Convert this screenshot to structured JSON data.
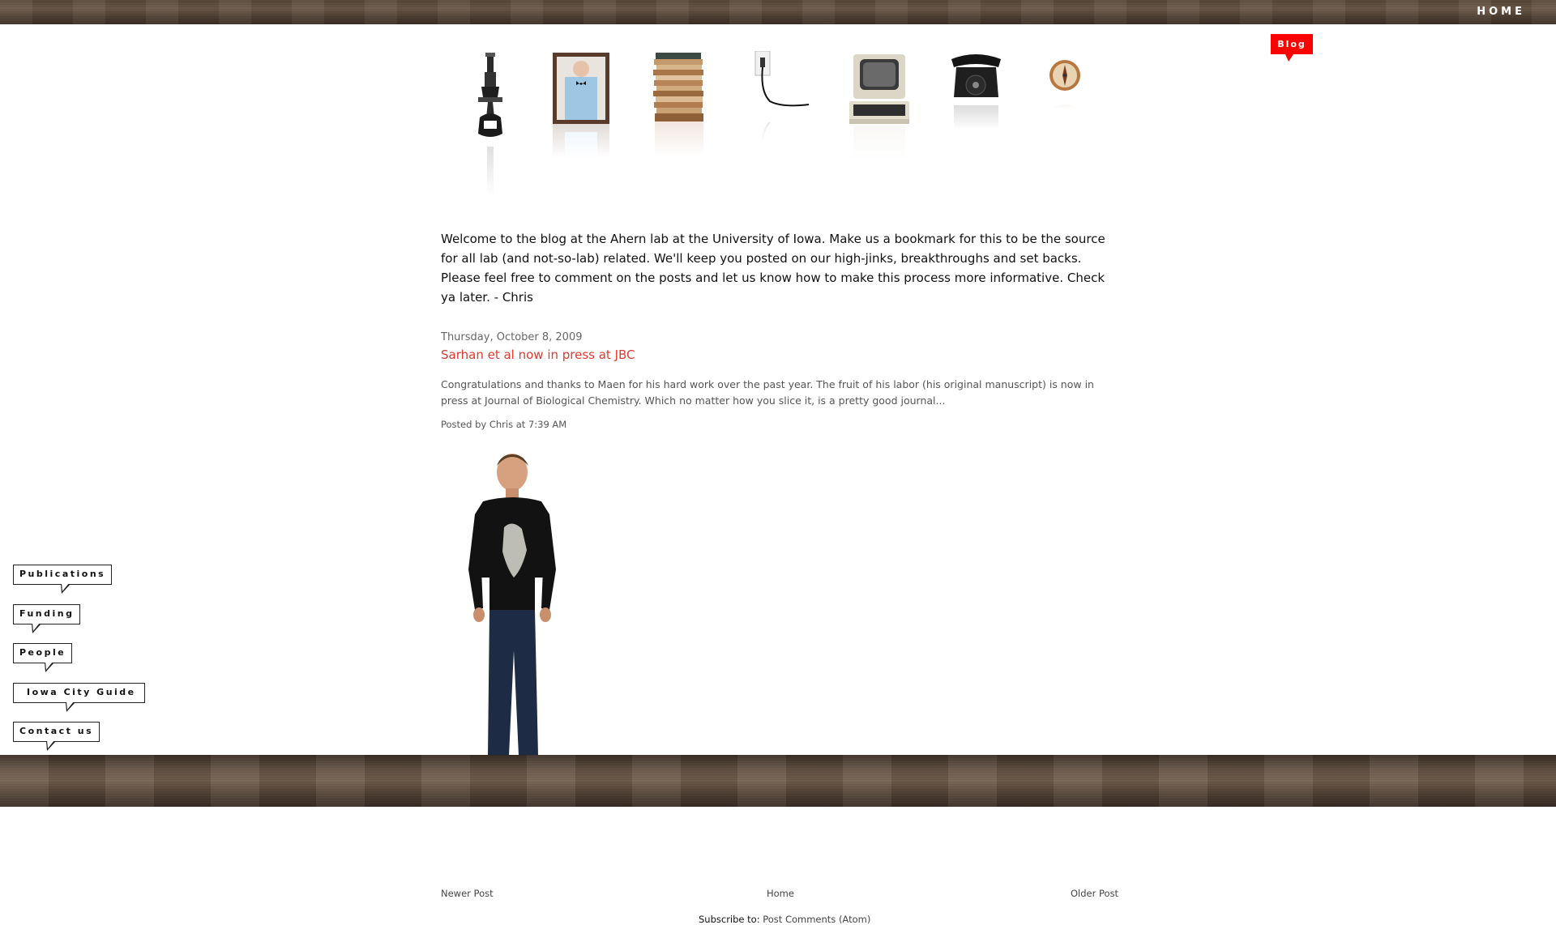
{
  "header": {
    "home_label": "HOME",
    "blog_label": "Blog"
  },
  "objects": [
    {
      "name": "microscope-icon"
    },
    {
      "name": "framed-portrait-icon"
    },
    {
      "name": "paper-stack-icon"
    },
    {
      "name": "power-plug-icon"
    },
    {
      "name": "computer-icon"
    },
    {
      "name": "telephone-icon"
    },
    {
      "name": "compass-icon"
    }
  ],
  "intro": {
    "text": "Welcome to the blog at the Ahern lab at the University of Iowa. Make us a bookmark for this to be the source for all lab (and not-so-lab) related. We'll keep you posted on our high-jinks, breakthroughs and set backs. Please feel free to comment on the posts and let us know how to make this process more informative. Check ya later. - Chris"
  },
  "post": {
    "date": "Thursday, October 8, 2009",
    "title": "Sarhan et al now in press at JBC",
    "body": "Congratulations and thanks to Maen for his hard work over the past year. The fruit of his labor (his original manuscript) is now in press at Journal of Biological Chemistry. Which no matter how you slice it, is a pretty good journal...",
    "footer": "Posted by Chris at 7:39 AM"
  },
  "sidebar": {
    "items": [
      {
        "label": "Publications"
      },
      {
        "label": "Funding"
      },
      {
        "label": "People"
      },
      {
        "label": "Iowa City Guide"
      },
      {
        "label": "Contact us"
      }
    ]
  },
  "footer": {
    "newer": "Newer Post",
    "home": "Home",
    "older": "Older Post",
    "subscribe_label": "Subscribe to:",
    "subscribe_link": "Post Comments (Atom)"
  },
  "colors": {
    "accent_red": "#ff0000",
    "title_red": "#e03a2f",
    "wood_dark": "#4f4034"
  }
}
